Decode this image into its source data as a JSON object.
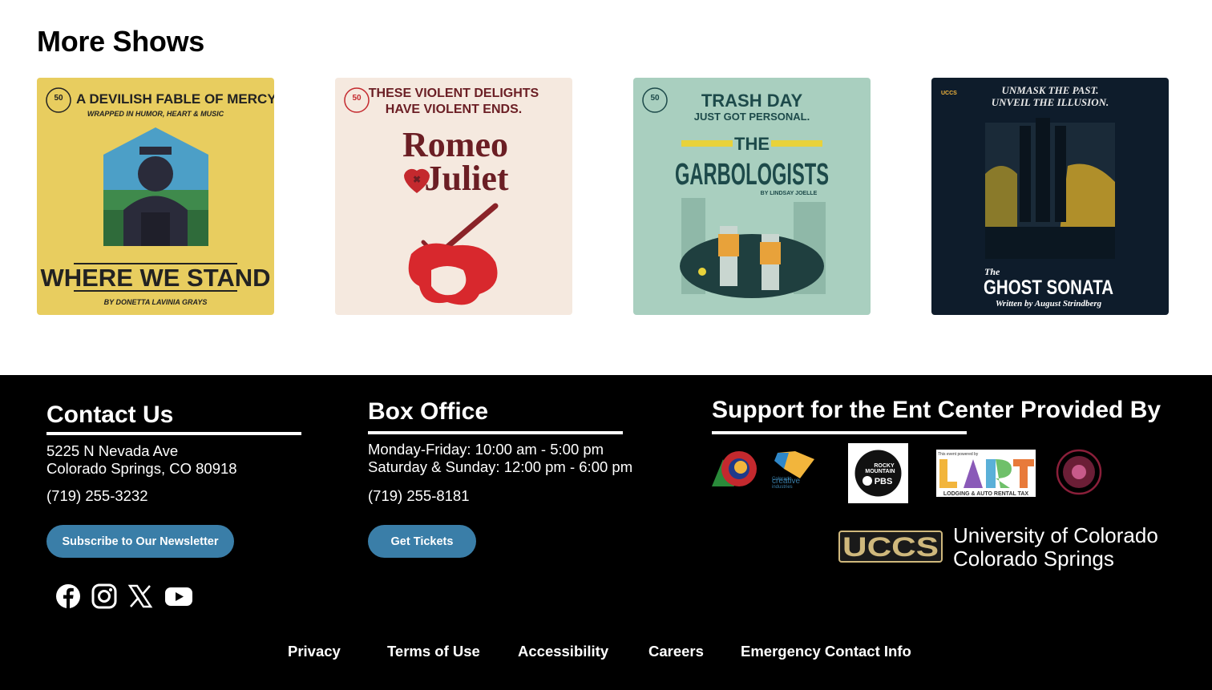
{
  "more_shows": {
    "title": "More Shows",
    "shows": [
      {
        "tagline": "A DEVILISH FABLE OF MERCY",
        "subline": "WRAPPED IN HUMOR, HEART & MUSIC",
        "title": "WHERE WE STAND",
        "credit": "BY DONETTA LAVINIA GRAYS",
        "bg": "#e8cd5f"
      },
      {
        "tagline_1": "THESE VIOLENT DELIGHTS",
        "tagline_2": "HAVE VIOLENT ENDS.",
        "title_1": "Romeo",
        "title_2": "Juliet",
        "bg": "#f5e9df"
      },
      {
        "tagline_1": "TRASH DAY",
        "tagline_2": "JUST GOT PERSONAL.",
        "title_1": "THE",
        "title_2": "GARBOLOGISTS",
        "credit": "BY LINDSAY JOELLE",
        "bg": "#a9cfbf"
      },
      {
        "tagline_1": "UNMASK THE PAST.",
        "tagline_2": "UNVEIL THE ILLUSION.",
        "title_1": "The",
        "title_2": "GHOST SONATA",
        "credit": "Written by August Strindberg",
        "org": "UCCS",
        "bg": "#0e1c2b"
      }
    ]
  },
  "contact": {
    "title": "Contact Us",
    "address_1": "5225 N Nevada Ave",
    "address_2": "Colorado Springs, CO 80918",
    "phone": "(719) 255-3232",
    "newsletter_label": "Subscribe to Our Newsletter"
  },
  "box_office": {
    "title": "Box Office",
    "hours_1": "Monday-Friday: 10:00 am - 5:00 pm",
    "hours_2": "Saturday & Sunday: 12:00 pm - 6:00 pm",
    "phone": "(719) 255-8181",
    "tickets_label": "Get Tickets"
  },
  "support": {
    "title": "Support for the Ent Center Provided By",
    "sponsors": [
      "colorado-creative-industries-logo",
      "rocky-mountain-pbs-logo",
      "lart-logo",
      "seal-logo"
    ],
    "pbs_text_1": "ROCKY",
    "pbs_text_2": "MOUNTAIN",
    "pbs_text_3": "PBS",
    "cci_text_1": "Colorado",
    "cci_text_2": "creative",
    "cci_text_3": "industries",
    "lart_text": "LART",
    "lart_caption": "LODGING & AUTO RENTAL TAX",
    "lart_top": "This event powered by",
    "uccs_mark": "UCCS",
    "uccs_name_1": "University of Colorado",
    "uccs_name_2": "Colorado Springs"
  },
  "social": [
    "facebook-icon",
    "instagram-icon",
    "x-icon",
    "youtube-icon"
  ],
  "footer_nav": [
    "Privacy",
    "Terms of Use",
    "Accessibility",
    "Careers",
    "Emergency Contact Info"
  ],
  "colors": {
    "button": "#3a7ea8",
    "footer_bg": "#000000",
    "accent_red": "#c4292e"
  }
}
